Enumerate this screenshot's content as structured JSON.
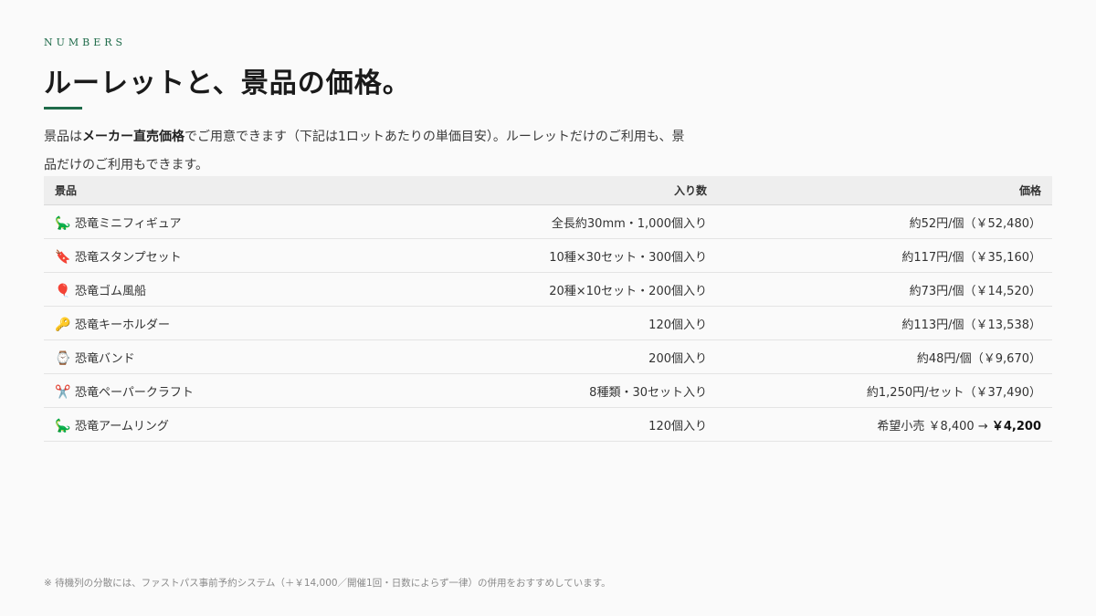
{
  "header": {
    "eyebrow": "NUMBERS",
    "title": "ルーレットと、景品の価格。"
  },
  "intro": {
    "part1": "景品は",
    "bold": "メーカー直売価格",
    "part2": "でご用意できます（下記は1ロットあたりの単価目安）。ルーレットだけのご利用も、景品だけのご利用もできます。"
  },
  "table": {
    "columns": [
      "景品",
      "入り数",
      "価格"
    ],
    "rows": [
      {
        "icon": "dinosaur-icon",
        "glyph": "🦕",
        "name": "恐竜ミニフィギュア",
        "qty": "全長約30mm・1,000個入り",
        "price": "約52円/個（￥52,480）"
      },
      {
        "icon": "bookmark-icon",
        "glyph": "🔖",
        "name": "恐竜スタンプセット",
        "qty": "10種×30セット・300個入り",
        "price": "約117円/個（￥35,160）"
      },
      {
        "icon": "balloon-icon",
        "glyph": "🎈",
        "name": "恐竜ゴム風船",
        "qty": "20種×10セット・200個入り",
        "price": "約73円/個（￥14,520）"
      },
      {
        "icon": "key-icon",
        "glyph": "🔑",
        "name": "恐竜キーホルダー",
        "qty": "120個入り",
        "price": "約113円/個（￥13,538）"
      },
      {
        "icon": "watch-icon",
        "glyph": "⌚",
        "name": "恐竜バンド",
        "qty": "200個入り",
        "price": "約48円/個（￥9,670）"
      },
      {
        "icon": "scissors-icon",
        "glyph": "✂️",
        "name": "恐竜ペーパークラフト",
        "qty": "8種類・30セット入り",
        "price": "約1,250円/セット（￥37,490）"
      },
      {
        "icon": "dinosaur-icon",
        "glyph": "🦕",
        "name": "恐竜アームリング",
        "qty": "120個入り",
        "price_prefix": "希望小売 ￥8,400 → ",
        "price_final": "￥4,200"
      }
    ]
  },
  "footnote": "※ 待機列の分散には、ファストパス事前予約システム（＋￥14,000／開催1回・日数によらず一律）の併用をおすすめしています。",
  "colors": {
    "accent": "#1f6b4a",
    "background": "#fafafa",
    "header_row": "#eeeeee"
  }
}
